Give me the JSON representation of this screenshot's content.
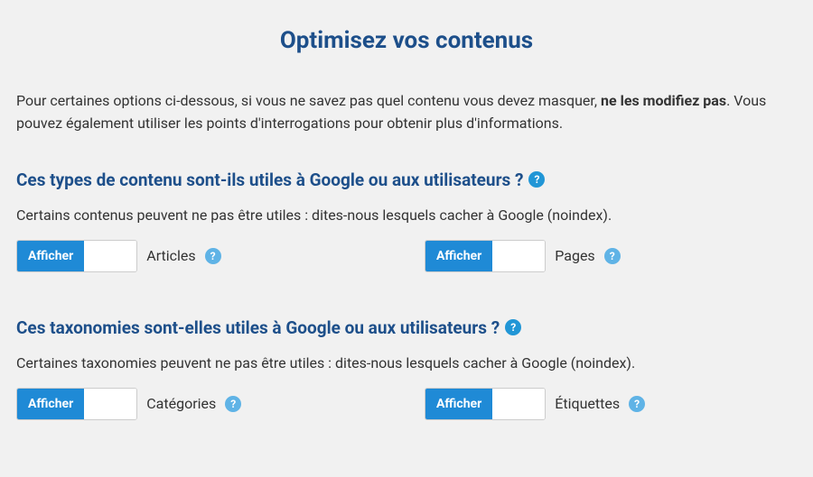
{
  "page_title": "Optimisez vos contenus",
  "intro": {
    "part1": "Pour certaines options ci-dessous, si vous ne savez pas quel contenu vous devez masquer, ",
    "strong": "ne les modifiez pas",
    "part2": ". Vous pouvez également utiliser les points d'interrogations pour obtenir plus d'informations."
  },
  "toggle": {
    "show": "Afficher",
    "hide": ""
  },
  "sections": [
    {
      "title": "Ces types de contenu sont-ils utiles à Google ou aux utilisateurs ?",
      "desc": "Certains contenus peuvent ne pas être utiles : dites-nous lesquels cacher à Google (noindex).",
      "items": [
        {
          "label": "Articles"
        },
        {
          "label": "Pages"
        }
      ]
    },
    {
      "title": "Ces taxonomies sont-elles utiles à Google ou aux utilisateurs ?",
      "desc": "Certaines taxonomies peuvent ne pas être utiles : dites-nous lesquels cacher à Google (noindex).",
      "items": [
        {
          "label": "Catégories"
        },
        {
          "label": "Étiquettes"
        }
      ]
    }
  ]
}
